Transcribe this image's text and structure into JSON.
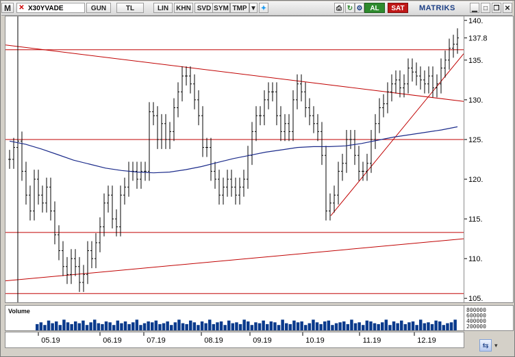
{
  "toolbar": {
    "logo": "M",
    "symbol": "X30YVADE",
    "buttons": [
      "GUN",
      "TL",
      "LIN",
      "KHN",
      "SVD",
      "SYM",
      "TMP"
    ],
    "al": "AL",
    "sat": "SAT",
    "brand": "MATRIKS"
  },
  "volume_panel": {
    "label": "Volume",
    "scale_labels": [
      "800000",
      "600000",
      "400000",
      "200000"
    ]
  },
  "colors": {
    "bar": "#000000",
    "support_resistance": "#c00000",
    "moving_average": "#1a2a8a",
    "volume": "#0a3a8c",
    "brand": "#1c3f86"
  },
  "chart_data": {
    "type": "ohlc",
    "title": "X30YVADE",
    "x_tick_labels": [
      "05.19",
      "06.19",
      "07.19",
      "08.19",
      "09.19",
      "10.19",
      "11.19",
      "12.19"
    ],
    "y_tick_labels": [
      "105.",
      "110.",
      "115.",
      "120.",
      "125.",
      "130.",
      "135.",
      "137.8",
      "140."
    ],
    "ylim": [
      104.5,
      140.5
    ],
    "last_price": 137.8,
    "close_series": [
      122.5,
      124,
      124.8,
      121,
      118,
      116,
      120,
      118,
      117,
      119,
      116,
      113,
      111,
      109,
      108,
      110,
      109,
      107,
      108,
      111,
      110,
      112,
      114,
      117,
      118,
      115,
      114,
      118,
      119,
      121,
      121,
      120,
      121,
      121,
      128.5,
      128,
      125,
      127,
      125,
      126,
      129,
      131,
      133,
      133,
      132,
      130,
      128,
      124,
      124,
      121,
      120,
      118,
      119,
      120,
      119,
      118,
      119,
      120,
      123,
      126,
      128,
      128,
      130,
      131,
      131,
      128,
      126,
      127,
      126,
      130,
      132,
      131,
      129,
      128,
      127,
      126,
      123,
      116,
      117,
      118,
      121,
      122,
      125,
      125,
      123,
      121,
      121,
      122,
      125,
      127,
      129,
      129.5,
      131,
      132,
      132.5,
      131.5,
      132,
      134,
      133.5,
      133,
      132.5,
      132,
      133,
      131.5,
      132,
      134,
      135,
      136.5,
      137,
      137.8
    ],
    "ma_series": [
      124.8,
      124.4,
      123.8,
      123.1,
      122.4,
      121.9,
      121.4,
      121.1,
      120.9,
      120.8,
      120.9,
      121.2,
      121.6,
      122.1,
      122.6,
      123,
      123.4,
      123.7,
      124,
      124.1,
      124.1,
      124.2,
      124.5,
      124.9,
      125.3,
      125.6,
      125.9,
      126.2,
      126.6
    ],
    "horizontal_levels": [
      105.6,
      113.3,
      125,
      136.3
    ],
    "trendlines": [
      {
        "from": [
          "start",
          136.9
        ],
        "to": [
          "end",
          129.8
        ]
      },
      {
        "from": [
          "start",
          107.2
        ],
        "to": [
          "end",
          112.5
        ]
      },
      {
        "from": [
          "10.19 +",
          115.4
        ],
        "to": [
          "end",
          135.8
        ]
      }
    ],
    "volume_values": [
      0.35,
      0.45,
      0.3,
      0.55,
      0.4,
      0.5,
      0.3,
      0.6,
      0.45,
      0.35,
      0.5,
      0.4,
      0.55,
      0.3,
      0.45,
      0.6,
      0.4,
      0.35,
      0.5,
      0.45,
      0.3,
      0.55,
      0.4,
      0.5,
      0.35,
      0.45,
      0.6,
      0.3,
      0.4,
      0.5,
      0.45,
      0.55,
      0.35,
      0.4,
      0.5,
      0.3,
      0.45,
      0.6,
      0.4,
      0.35,
      0.55,
      0.45,
      0.3,
      0.5,
      0.4,
      0.6,
      0.35,
      0.45,
      0.5,
      0.3,
      0.55,
      0.4,
      0.45,
      0.35,
      0.6,
      0.5,
      0.3,
      0.45,
      0.4,
      0.55,
      0.35,
      0.5,
      0.45,
      0.3,
      0.6,
      0.4,
      0.35,
      0.55,
      0.45,
      0.5,
      0.3,
      0.4,
      0.6,
      0.45,
      0.35,
      0.5,
      0.55,
      0.3,
      0.4,
      0.45,
      0.5,
      0.35,
      0.6,
      0.4,
      0.45,
      0.3,
      0.55,
      0.5,
      0.4,
      0.35,
      0.45,
      0.6,
      0.3,
      0.5,
      0.4,
      0.55,
      0.35,
      0.45,
      0.5,
      0.3,
      0.6,
      0.4,
      0.45,
      0.35,
      0.55,
      0.5,
      0.3,
      0.4,
      0.45,
      0.6
    ]
  }
}
